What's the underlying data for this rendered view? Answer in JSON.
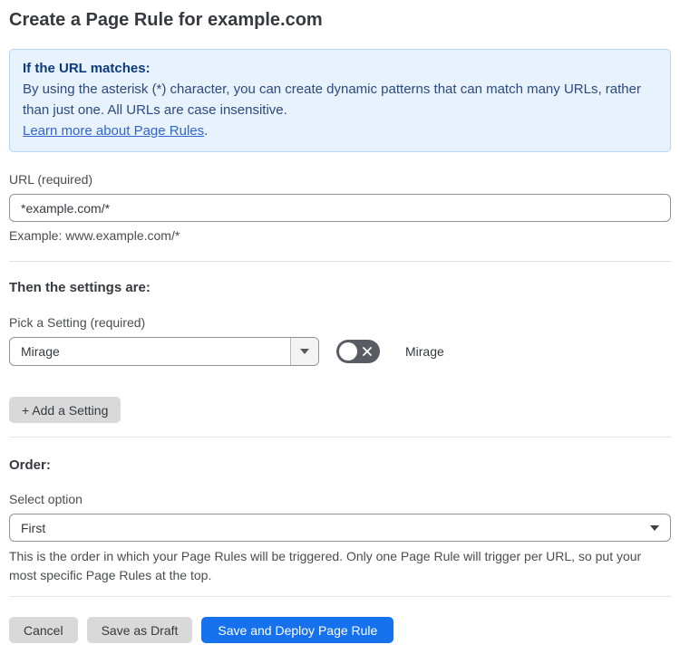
{
  "page": {
    "title": "Create a Page Rule for example.com"
  },
  "info_box": {
    "heading": "If the URL matches:",
    "body": "By using the asterisk (*) character, you can create dynamic patterns that can match many URLs, rather than just one. All URLs are case insensitive.",
    "link_label": "Learn more about Page Rules",
    "link_suffix": "."
  },
  "url_field": {
    "label": "URL (required)",
    "value": "*example.com/*",
    "example": "Example: www.example.com/*"
  },
  "settings_section": {
    "heading": "Then the settings are:",
    "pick_label": "Pick a Setting (required)",
    "selected_setting": "Mirage",
    "toggle_label": "Mirage",
    "toggle_state": "off",
    "add_setting_label": "+ Add a Setting"
  },
  "order_section": {
    "heading": "Order:",
    "select_label": "Select option",
    "selected_option": "First",
    "help_text": "This is the order in which your Page Rules will be triggered. Only one Page Rule will trigger per URL, so put your most specific Page Rules at the top."
  },
  "footer": {
    "cancel_label": "Cancel",
    "save_draft_label": "Save as Draft",
    "save_deploy_label": "Save and Deploy Page Rule"
  },
  "colors": {
    "accent_blue": "#1672ec",
    "info_bg": "#e8f2fc",
    "info_border": "#b7d5f3",
    "info_heading": "#0c3b7c",
    "info_body": "#2b4a80",
    "link_blue": "#2f66d0",
    "toggle_off_bg": "#595d63",
    "button_gray": "#d9d9d9"
  }
}
